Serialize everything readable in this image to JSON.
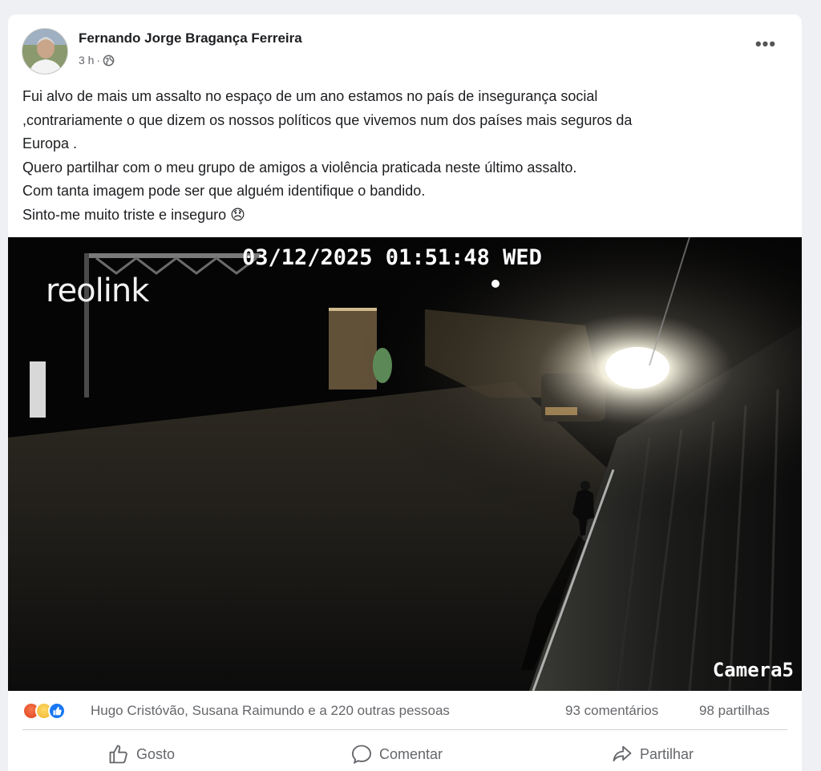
{
  "post": {
    "author": "Fernando Jorge Bragança Ferreira",
    "time": "3 h",
    "separator": "·",
    "audience_icon": "globe-icon",
    "more_icon": "more-options-icon",
    "text_lines": [
      "Fui alvo de mais um assalto no espaço de um ano estamos no país de insegurança social",
      ",contrariamente o que dizem os nossos políticos que vivemos num dos países mais seguros da",
      "Europa .",
      "Quero partilhar com o meu grupo de amigos a violência praticada neste último assalto.",
      "Com tanta imagem pode ser que alguém identifique o bandido.",
      "Sinto-me muito triste e inseguro 😞"
    ]
  },
  "photo": {
    "timestamp": "03/12/2025 01:51:48 WED",
    "brand": "reolink",
    "camera_label": "Camera5"
  },
  "stats": {
    "reaction_icons": [
      "angry-reaction-icon",
      "sad-reaction-icon",
      "like-reaction-icon"
    ],
    "reaction_summary": "Hugo Cristóvão, Susana Raimundo e a 220 outras pessoas",
    "comments": "93 comentários",
    "shares": "98 partilhas"
  },
  "actions": {
    "like": "Gosto",
    "comment": "Comentar",
    "share": "Partilhar"
  },
  "colors": {
    "background": "#eef0f3",
    "card": "#ffffff",
    "secondary_text": "#65676b",
    "like_blue": "#1877f2"
  }
}
